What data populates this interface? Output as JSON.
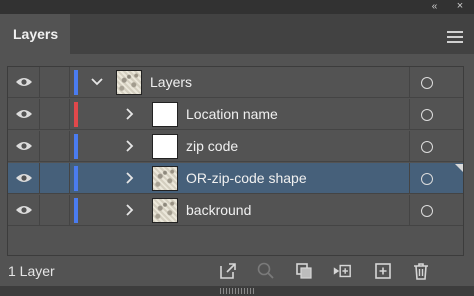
{
  "panel": {
    "tab_label": "Layers",
    "collapse_glyph": "«",
    "close_glyph": "×"
  },
  "icons": {
    "visibility": "eye-icon",
    "expand": "chevron-right-icon",
    "collapse": "chevron-down-icon",
    "target": "target-circle-icon",
    "menu": "hamburger-menu-icon"
  },
  "layers": [
    {
      "name": "Layers",
      "color": "#4a7cf0",
      "expanded": true,
      "thumb": "map-partial",
      "selected": false,
      "top_level": true
    },
    {
      "name": "Location name",
      "color": "#e0484b",
      "expanded": false,
      "thumb": "blank",
      "selected": false,
      "top_level": false
    },
    {
      "name": "zip code",
      "color": "#4a7cf0",
      "expanded": false,
      "thumb": "blank",
      "selected": false,
      "top_level": false
    },
    {
      "name": "OR-zip-code shape",
      "color": "#4a7cf0",
      "expanded": false,
      "thumb": "map",
      "selected": true,
      "top_level": false
    },
    {
      "name": "backround",
      "color": "#4a7cf0",
      "expanded": false,
      "thumb": "map",
      "selected": false,
      "top_level": false
    }
  ],
  "footer": {
    "layer_count": "1 Layer",
    "actions": [
      "export-icon",
      "search-icon",
      "clipping-mask-icon",
      "new-sublayer-icon",
      "new-layer-icon",
      "trash-icon"
    ]
  },
  "colors": {
    "panel_bg": "#535353",
    "selected_row": "#46607a",
    "accent_blue": "#4a7cf0",
    "accent_red": "#e0484b"
  }
}
